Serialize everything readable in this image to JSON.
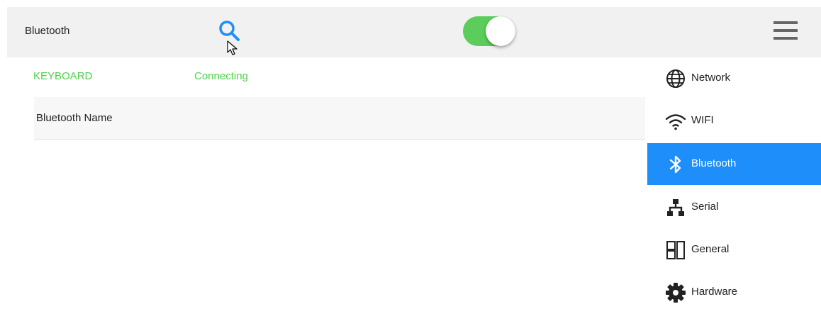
{
  "header": {
    "title": "Bluetooth",
    "search_icon": "search-icon",
    "toggle_state": "on",
    "menu_icon": "hamburger-menu-icon"
  },
  "device": {
    "name": "KEYBOARD",
    "status": "Connecting"
  },
  "list": {
    "header_label": "Bluetooth Name"
  },
  "sidebar": {
    "active_index": 2,
    "items": [
      {
        "label": "Network",
        "icon": "globe-icon"
      },
      {
        "label": "WIFI",
        "icon": "wifi-icon"
      },
      {
        "label": "Bluetooth",
        "icon": "bluetooth-icon"
      },
      {
        "label": "Serial",
        "icon": "network-tree-icon"
      },
      {
        "label": "General",
        "icon": "layout-panels-icon"
      },
      {
        "label": "Hardware",
        "icon": "gear-icon"
      }
    ]
  },
  "colors": {
    "accent": "#1e8ffa",
    "toggle_on": "#5ccd5a",
    "status_green": "#4cd14c",
    "topbar_bg": "#f1f1f1"
  }
}
